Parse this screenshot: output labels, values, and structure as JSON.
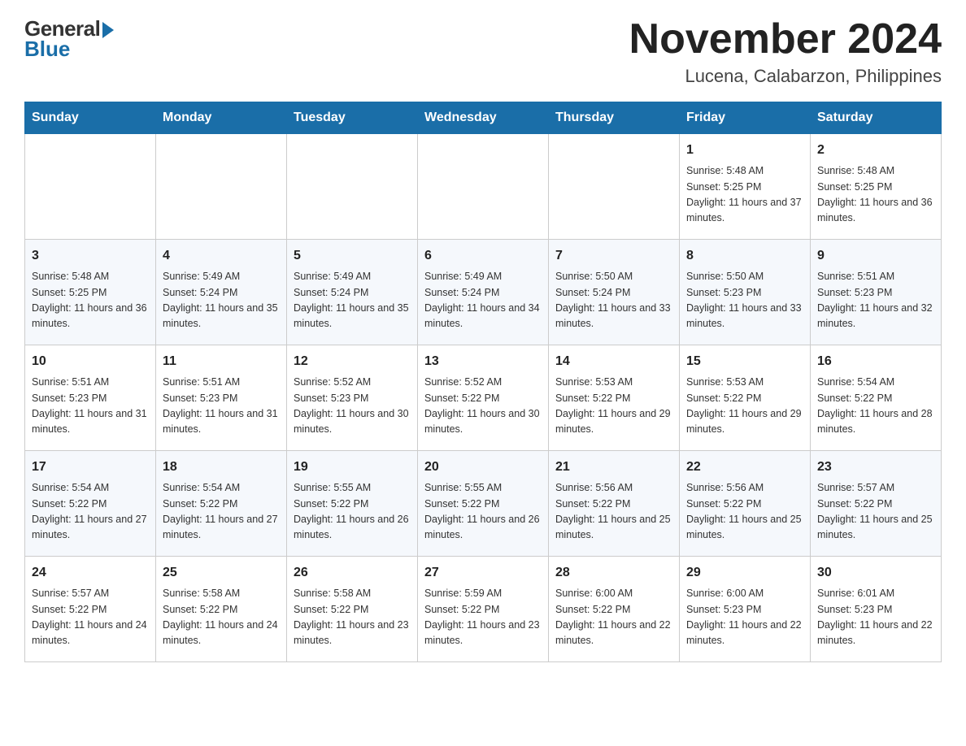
{
  "logo": {
    "general": "General",
    "blue": "Blue"
  },
  "title": "November 2024",
  "subtitle": "Lucena, Calabarzon, Philippines",
  "weekdays": [
    "Sunday",
    "Monday",
    "Tuesday",
    "Wednesday",
    "Thursday",
    "Friday",
    "Saturday"
  ],
  "weeks": [
    [
      {
        "day": "",
        "sunrise": "",
        "sunset": "",
        "daylight": ""
      },
      {
        "day": "",
        "sunrise": "",
        "sunset": "",
        "daylight": ""
      },
      {
        "day": "",
        "sunrise": "",
        "sunset": "",
        "daylight": ""
      },
      {
        "day": "",
        "sunrise": "",
        "sunset": "",
        "daylight": ""
      },
      {
        "day": "",
        "sunrise": "",
        "sunset": "",
        "daylight": ""
      },
      {
        "day": "1",
        "sunrise": "Sunrise: 5:48 AM",
        "sunset": "Sunset: 5:25 PM",
        "daylight": "Daylight: 11 hours and 37 minutes."
      },
      {
        "day": "2",
        "sunrise": "Sunrise: 5:48 AM",
        "sunset": "Sunset: 5:25 PM",
        "daylight": "Daylight: 11 hours and 36 minutes."
      }
    ],
    [
      {
        "day": "3",
        "sunrise": "Sunrise: 5:48 AM",
        "sunset": "Sunset: 5:25 PM",
        "daylight": "Daylight: 11 hours and 36 minutes."
      },
      {
        "day": "4",
        "sunrise": "Sunrise: 5:49 AM",
        "sunset": "Sunset: 5:24 PM",
        "daylight": "Daylight: 11 hours and 35 minutes."
      },
      {
        "day": "5",
        "sunrise": "Sunrise: 5:49 AM",
        "sunset": "Sunset: 5:24 PM",
        "daylight": "Daylight: 11 hours and 35 minutes."
      },
      {
        "day": "6",
        "sunrise": "Sunrise: 5:49 AM",
        "sunset": "Sunset: 5:24 PM",
        "daylight": "Daylight: 11 hours and 34 minutes."
      },
      {
        "day": "7",
        "sunrise": "Sunrise: 5:50 AM",
        "sunset": "Sunset: 5:24 PM",
        "daylight": "Daylight: 11 hours and 33 minutes."
      },
      {
        "day": "8",
        "sunrise": "Sunrise: 5:50 AM",
        "sunset": "Sunset: 5:23 PM",
        "daylight": "Daylight: 11 hours and 33 minutes."
      },
      {
        "day": "9",
        "sunrise": "Sunrise: 5:51 AM",
        "sunset": "Sunset: 5:23 PM",
        "daylight": "Daylight: 11 hours and 32 minutes."
      }
    ],
    [
      {
        "day": "10",
        "sunrise": "Sunrise: 5:51 AM",
        "sunset": "Sunset: 5:23 PM",
        "daylight": "Daylight: 11 hours and 31 minutes."
      },
      {
        "day": "11",
        "sunrise": "Sunrise: 5:51 AM",
        "sunset": "Sunset: 5:23 PM",
        "daylight": "Daylight: 11 hours and 31 minutes."
      },
      {
        "day": "12",
        "sunrise": "Sunrise: 5:52 AM",
        "sunset": "Sunset: 5:23 PM",
        "daylight": "Daylight: 11 hours and 30 minutes."
      },
      {
        "day": "13",
        "sunrise": "Sunrise: 5:52 AM",
        "sunset": "Sunset: 5:22 PM",
        "daylight": "Daylight: 11 hours and 30 minutes."
      },
      {
        "day": "14",
        "sunrise": "Sunrise: 5:53 AM",
        "sunset": "Sunset: 5:22 PM",
        "daylight": "Daylight: 11 hours and 29 minutes."
      },
      {
        "day": "15",
        "sunrise": "Sunrise: 5:53 AM",
        "sunset": "Sunset: 5:22 PM",
        "daylight": "Daylight: 11 hours and 29 minutes."
      },
      {
        "day": "16",
        "sunrise": "Sunrise: 5:54 AM",
        "sunset": "Sunset: 5:22 PM",
        "daylight": "Daylight: 11 hours and 28 minutes."
      }
    ],
    [
      {
        "day": "17",
        "sunrise": "Sunrise: 5:54 AM",
        "sunset": "Sunset: 5:22 PM",
        "daylight": "Daylight: 11 hours and 27 minutes."
      },
      {
        "day": "18",
        "sunrise": "Sunrise: 5:54 AM",
        "sunset": "Sunset: 5:22 PM",
        "daylight": "Daylight: 11 hours and 27 minutes."
      },
      {
        "day": "19",
        "sunrise": "Sunrise: 5:55 AM",
        "sunset": "Sunset: 5:22 PM",
        "daylight": "Daylight: 11 hours and 26 minutes."
      },
      {
        "day": "20",
        "sunrise": "Sunrise: 5:55 AM",
        "sunset": "Sunset: 5:22 PM",
        "daylight": "Daylight: 11 hours and 26 minutes."
      },
      {
        "day": "21",
        "sunrise": "Sunrise: 5:56 AM",
        "sunset": "Sunset: 5:22 PM",
        "daylight": "Daylight: 11 hours and 25 minutes."
      },
      {
        "day": "22",
        "sunrise": "Sunrise: 5:56 AM",
        "sunset": "Sunset: 5:22 PM",
        "daylight": "Daylight: 11 hours and 25 minutes."
      },
      {
        "day": "23",
        "sunrise": "Sunrise: 5:57 AM",
        "sunset": "Sunset: 5:22 PM",
        "daylight": "Daylight: 11 hours and 25 minutes."
      }
    ],
    [
      {
        "day": "24",
        "sunrise": "Sunrise: 5:57 AM",
        "sunset": "Sunset: 5:22 PM",
        "daylight": "Daylight: 11 hours and 24 minutes."
      },
      {
        "day": "25",
        "sunrise": "Sunrise: 5:58 AM",
        "sunset": "Sunset: 5:22 PM",
        "daylight": "Daylight: 11 hours and 24 minutes."
      },
      {
        "day": "26",
        "sunrise": "Sunrise: 5:58 AM",
        "sunset": "Sunset: 5:22 PM",
        "daylight": "Daylight: 11 hours and 23 minutes."
      },
      {
        "day": "27",
        "sunrise": "Sunrise: 5:59 AM",
        "sunset": "Sunset: 5:22 PM",
        "daylight": "Daylight: 11 hours and 23 minutes."
      },
      {
        "day": "28",
        "sunrise": "Sunrise: 6:00 AM",
        "sunset": "Sunset: 5:22 PM",
        "daylight": "Daylight: 11 hours and 22 minutes."
      },
      {
        "day": "29",
        "sunrise": "Sunrise: 6:00 AM",
        "sunset": "Sunset: 5:23 PM",
        "daylight": "Daylight: 11 hours and 22 minutes."
      },
      {
        "day": "30",
        "sunrise": "Sunrise: 6:01 AM",
        "sunset": "Sunset: 5:23 PM",
        "daylight": "Daylight: 11 hours and 22 minutes."
      }
    ]
  ]
}
